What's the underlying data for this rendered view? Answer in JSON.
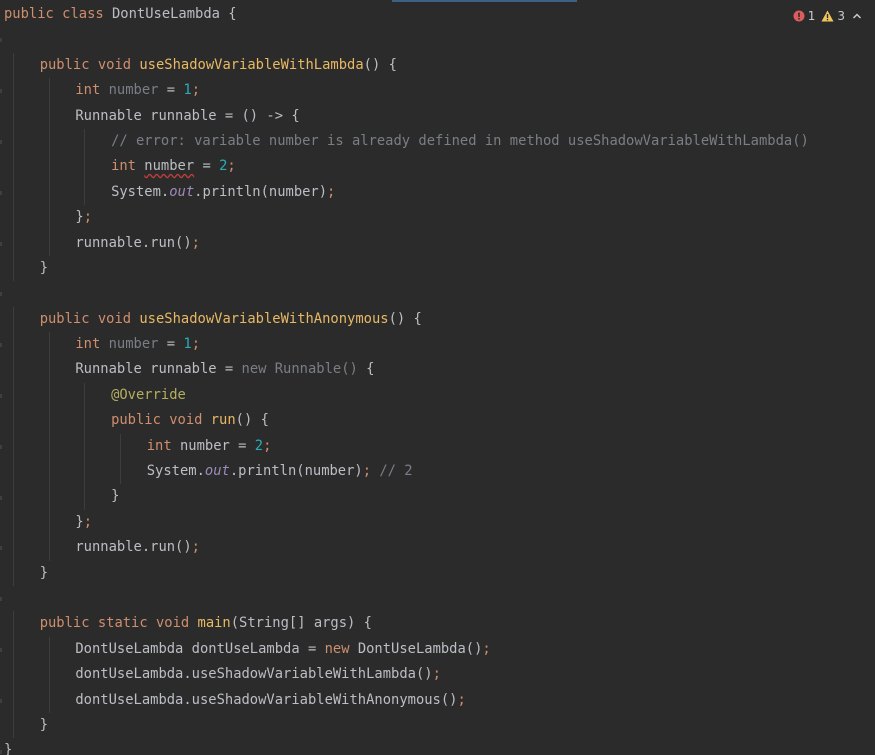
{
  "window": {
    "inspection": {
      "errors_count": "1",
      "warnings_count": "3",
      "error_icon": "error-icon",
      "warning_icon": "warning-icon",
      "collapse_icon": "chevron-up-icon"
    }
  },
  "colors": {
    "background": "#2b2b2b",
    "keyword": "#cf8e6d",
    "method": "#e8b964",
    "number": "#2aacb8",
    "comment": "#7a7e85",
    "static_field": "#9d8ab8",
    "annotation": "#b3ae60",
    "text": "#bcbec4",
    "error_count": "#db5c5c",
    "warning_count": "#f2c55c"
  },
  "editor": {
    "lines": [
      {
        "indent": 0,
        "tokens": [
          {
            "t": "public class ",
            "c": "kw"
          },
          {
            "t": "DontUseLambda {",
            "c": "var"
          }
        ]
      },
      {
        "indent": 0,
        "tokens": []
      },
      {
        "indent": 1,
        "tokens": [
          {
            "t": "public void ",
            "c": "kw"
          },
          {
            "t": "useShadowVariableWithLambda",
            "c": "fn"
          },
          {
            "t": "() {",
            "c": "var"
          }
        ]
      },
      {
        "indent": 2,
        "tokens": [
          {
            "t": "int ",
            "c": "kw"
          },
          {
            "t": "number",
            "c": "dim"
          },
          {
            "t": " = ",
            "c": "var"
          },
          {
            "t": "1",
            "c": "num"
          },
          {
            "t": ";",
            "c": "kw"
          }
        ]
      },
      {
        "indent": 2,
        "tokens": [
          {
            "t": "Runnable runnable = () -> {",
            "c": "var"
          }
        ]
      },
      {
        "indent": 3,
        "tokens": [
          {
            "t": "// error: variable number is already defined in method useShadowVariableWithLambda()",
            "c": "cm"
          }
        ]
      },
      {
        "indent": 3,
        "tokens": [
          {
            "t": "int ",
            "c": "kw"
          },
          {
            "t": "number",
            "c": "var",
            "err": true
          },
          {
            "t": " = ",
            "c": "var"
          },
          {
            "t": "2",
            "c": "num"
          },
          {
            "t": ";",
            "c": "kw"
          }
        ]
      },
      {
        "indent": 3,
        "tokens": [
          {
            "t": "System.",
            "c": "var"
          },
          {
            "t": "out",
            "c": "it"
          },
          {
            "t": ".println(number)",
            "c": "var"
          },
          {
            "t": ";",
            "c": "kw"
          }
        ]
      },
      {
        "indent": 2,
        "tokens": [
          {
            "t": "}",
            "c": "var"
          },
          {
            "t": ";",
            "c": "kw"
          }
        ]
      },
      {
        "indent": 2,
        "tokens": [
          {
            "t": "runnable.run()",
            "c": "var"
          },
          {
            "t": ";",
            "c": "kw"
          }
        ]
      },
      {
        "indent": 1,
        "tokens": [
          {
            "t": "}",
            "c": "var"
          }
        ]
      },
      {
        "indent": 0,
        "tokens": []
      },
      {
        "indent": 1,
        "tokens": [
          {
            "t": "public void ",
            "c": "kw"
          },
          {
            "t": "useShadowVariableWithAnonymous",
            "c": "fn"
          },
          {
            "t": "() {",
            "c": "var"
          }
        ]
      },
      {
        "indent": 2,
        "tokens": [
          {
            "t": "int ",
            "c": "kw"
          },
          {
            "t": "number",
            "c": "dim"
          },
          {
            "t": " = ",
            "c": "var"
          },
          {
            "t": "1",
            "c": "num"
          },
          {
            "t": ";",
            "c": "kw"
          }
        ]
      },
      {
        "indent": 2,
        "tokens": [
          {
            "t": "Runnable runnable = ",
            "c": "var"
          },
          {
            "t": "new Runnable()",
            "c": "dim"
          },
          {
            "t": " {",
            "c": "var"
          }
        ]
      },
      {
        "indent": 3,
        "tokens": [
          {
            "t": "@Override",
            "c": "an"
          }
        ]
      },
      {
        "indent": 3,
        "tokens": [
          {
            "t": "public void ",
            "c": "kw"
          },
          {
            "t": "run",
            "c": "fn"
          },
          {
            "t": "() {",
            "c": "var"
          }
        ]
      },
      {
        "indent": 4,
        "tokens": [
          {
            "t": "int ",
            "c": "kw"
          },
          {
            "t": "number = ",
            "c": "var"
          },
          {
            "t": "2",
            "c": "num"
          },
          {
            "t": ";",
            "c": "kw"
          }
        ]
      },
      {
        "indent": 4,
        "tokens": [
          {
            "t": "System.",
            "c": "var"
          },
          {
            "t": "out",
            "c": "it"
          },
          {
            "t": ".println(number)",
            "c": "var"
          },
          {
            "t": "; ",
            "c": "kw"
          },
          {
            "t": "// 2",
            "c": "cm"
          }
        ]
      },
      {
        "indent": 3,
        "tokens": [
          {
            "t": "}",
            "c": "var"
          }
        ]
      },
      {
        "indent": 2,
        "tokens": [
          {
            "t": "}",
            "c": "var"
          },
          {
            "t": ";",
            "c": "kw"
          }
        ]
      },
      {
        "indent": 2,
        "tokens": [
          {
            "t": "runnable.run()",
            "c": "var"
          },
          {
            "t": ";",
            "c": "kw"
          }
        ]
      },
      {
        "indent": 1,
        "tokens": [
          {
            "t": "}",
            "c": "var"
          }
        ]
      },
      {
        "indent": 0,
        "tokens": []
      },
      {
        "indent": 1,
        "tokens": [
          {
            "t": "public static void ",
            "c": "kw"
          },
          {
            "t": "main",
            "c": "fn"
          },
          {
            "t": "(String[] args) {",
            "c": "var"
          }
        ]
      },
      {
        "indent": 2,
        "tokens": [
          {
            "t": "DontUseLambda dontUseLambda = ",
            "c": "var"
          },
          {
            "t": "new ",
            "c": "kw"
          },
          {
            "t": "DontUseLambda()",
            "c": "var"
          },
          {
            "t": ";",
            "c": "kw"
          }
        ]
      },
      {
        "indent": 2,
        "tokens": [
          {
            "t": "dontUseLambda.useShadowVariableWithLambda()",
            "c": "var"
          },
          {
            "t": ";",
            "c": "kw"
          }
        ]
      },
      {
        "indent": 2,
        "tokens": [
          {
            "t": "dontUseLambda.useShadowVariableWithAnonymous()",
            "c": "var"
          },
          {
            "t": ";",
            "c": "kw"
          }
        ]
      },
      {
        "indent": 1,
        "tokens": [
          {
            "t": "}",
            "c": "var"
          }
        ]
      },
      {
        "indent": 0,
        "tokens": [
          {
            "t": "}",
            "c": "var"
          }
        ]
      }
    ]
  }
}
